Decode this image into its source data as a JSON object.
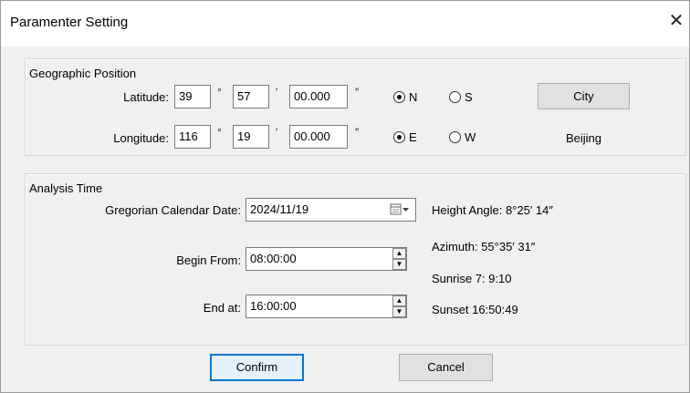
{
  "window": {
    "title": "Paramenter Setting",
    "close_glyph": "✕"
  },
  "geo": {
    "title": "Geographic Position",
    "latitude": {
      "label": "Latitude:",
      "deg": "39",
      "min": "57",
      "sec": "00.000",
      "deg_sym": "°",
      "min_sym": "′",
      "sec_sym": "″"
    },
    "longitude": {
      "label": "Longitude:",
      "deg": "116",
      "min": "19",
      "sec": "00.000",
      "deg_sym": "°",
      "min_sym": "′",
      "sec_sym": "″"
    },
    "lat_radios": [
      {
        "label": "N",
        "selected": true
      },
      {
        "label": "S",
        "selected": false
      }
    ],
    "lon_radios": [
      {
        "label": "E",
        "selected": true
      },
      {
        "label": "W",
        "selected": false
      }
    ],
    "city_button": "City",
    "city_name": "Beijing"
  },
  "time": {
    "title": "Analysis Time",
    "date_label": "Gregorian Calendar Date:",
    "date_value": "2024/11/19",
    "begin_label": "Begin From:",
    "begin_value": "08:00:00",
    "end_label": "End at:",
    "end_value": "16:00:00",
    "height_angle": "Height Angle: 8°25′ 14″",
    "azimuth": "Azimuth: 55°35′ 31″",
    "sunrise": "Sunrise  7: 9:10",
    "sunset": "Sunset 16:50:49"
  },
  "buttons": {
    "confirm": "Confirm",
    "cancel": "Cancel"
  },
  "icons": {
    "close": "close-icon",
    "calendar": "calendar-dropdown-icon",
    "spin_up": "spin-up-icon",
    "spin_down": "spin-down-icon"
  },
  "colors": {
    "default_button_border": "#0078d7",
    "title_bg": "#ffffff",
    "dialog_bg": "#f0f0f0"
  }
}
